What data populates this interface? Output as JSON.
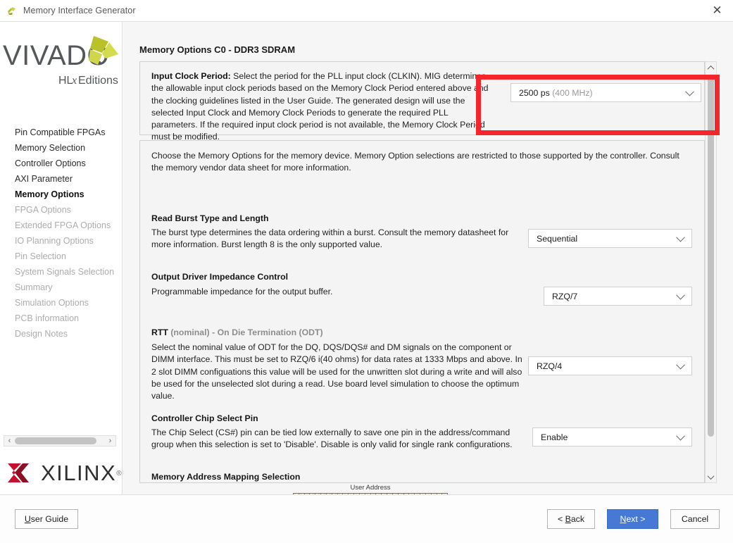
{
  "window": {
    "title": "Memory Interface Generator",
    "app_icon": "vivado-logo-icon",
    "close_label": "✕"
  },
  "sidebar": {
    "brand": {
      "product": "VIVADO",
      "edition": "HLx Editions",
      "vendor": "XILINX",
      "vendor_mark": "®"
    },
    "items": [
      {
        "label": "Pin Compatible FPGAs",
        "state": "enabled"
      },
      {
        "label": "Memory Selection",
        "state": "enabled"
      },
      {
        "label": "Controller Options",
        "state": "enabled"
      },
      {
        "label": "AXI Parameter",
        "state": "enabled"
      },
      {
        "label": "Memory Options",
        "state": "active"
      },
      {
        "label": "FPGA Options",
        "state": "disabled"
      },
      {
        "label": "Extended FPGA Options",
        "state": "disabled"
      },
      {
        "label": "IO Planning Options",
        "state": "disabled"
      },
      {
        "label": "Pin Selection",
        "state": "disabled"
      },
      {
        "label": "System Signals Selection",
        "state": "disabled"
      },
      {
        "label": "Summary",
        "state": "disabled"
      },
      {
        "label": "Simulation Options",
        "state": "disabled"
      },
      {
        "label": "PCB information",
        "state": "disabled"
      },
      {
        "label": "Design Notes",
        "state": "disabled"
      }
    ],
    "hscroll": {
      "left_arrow": "‹",
      "right_arrow": "›"
    }
  },
  "main": {
    "page_title": "Memory Options C0 - DDR3 SDRAM",
    "input_clock": {
      "label": "Input Clock Period:",
      "description": " Select the period for the PLL input clock (CLKIN). MIG determines the allowable input clock periods based on the Memory Clock Period entered above and the clocking guidelines listed in the User Guide. The generated design will use the selected Input Clock and Memory Clock Periods to generate the required PLL parameters. If the required input clock period is not available, the Memory Clock Period must be modified.",
      "value": "2500 ps",
      "value_suffix": "(400 MHz)"
    },
    "intro": "Choose the Memory Options for the memory device. Memory Option selections are restricted to those supported by the controller. Consult the memory vendor data sheet for more information.",
    "sections": [
      {
        "heading": "Read Burst Type and Length",
        "description": "The burst type determines the data ordering within a burst. Consult the memory datasheet for more information. Burst length 8 is the only supported value.",
        "value": "Sequential"
      },
      {
        "heading": "Output Driver Impedance Control",
        "description": "Programmable impedance for the output buffer.",
        "value": "RZQ/7"
      },
      {
        "heading_bold": "RTT",
        "heading_gray": " (nominal) - On Die Termination (ODT)",
        "description": "Select the nominal value of ODT for the DQ, DQS/DQS# and DM signals on the component or DIMM interface. This must be set to RZQ/6 i(40 ohms) for data rates at 1333 Mbps and above. In 2 slot DIMM configuations this value will be used for the unwritten slot during a write and will also be used for the unselected slot during a read. Use board level simulation to choose the optimum value.",
        "value": "RZQ/4"
      },
      {
        "heading": "Controller Chip Select Pin",
        "description": "The Chip Select (CS#) pin can be tied low externally to save one pin in the address/command group when this selection is set to 'Disable'. Disable is only valid for single rank configurations.",
        "value": "Enable"
      },
      {
        "heading": "Memory Address Mapping Selection",
        "ruler_label": "User Address"
      }
    ],
    "scrollbar": {
      "up": "scroll-up-arrow",
      "down": "scroll-down-arrow"
    }
  },
  "annotation": {
    "color": "#f5262b",
    "target": "input-clock-period-combo"
  },
  "footer": {
    "user_guide": {
      "pre": "",
      "mnemonic": "U",
      "post": "ser Guide"
    },
    "back": {
      "pre": "< ",
      "mnemonic": "B",
      "post": "ack"
    },
    "next": {
      "pre": "",
      "mnemonic": "N",
      "post": "ext >"
    },
    "cancel": {
      "pre": "",
      "mnemonic": "",
      "post": "Cancel"
    }
  }
}
